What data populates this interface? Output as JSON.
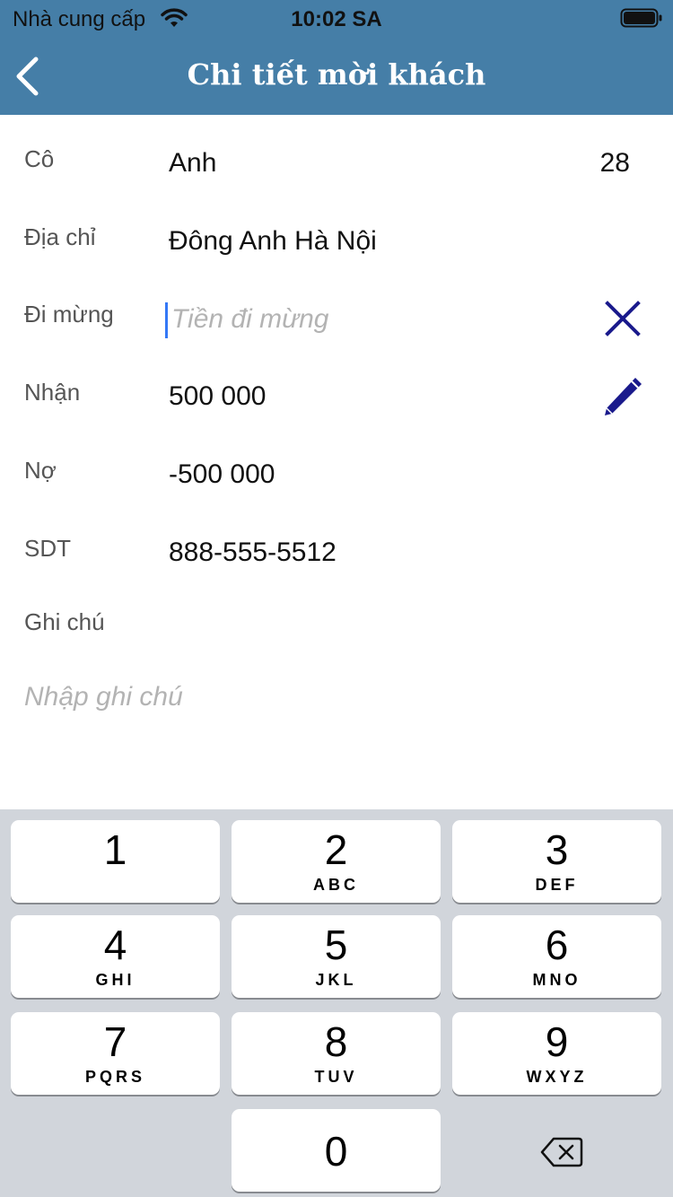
{
  "status_bar": {
    "carrier": "Nhà cung cấp",
    "time": "10:02 SA",
    "wifi_icon": "wifi-icon",
    "battery_icon": "battery-icon"
  },
  "header": {
    "title": "Chi tiết mời khách",
    "back_icon": "chevron-left-icon",
    "background_color": "#457ea7"
  },
  "form": {
    "guest": {
      "label": "Cô",
      "name": "Anh",
      "age": "28"
    },
    "address": {
      "label": "Địa chỉ",
      "value": "Đông Anh Hà Nội"
    },
    "gift": {
      "label": "Đi mừng",
      "value": "",
      "placeholder": "Tiền đi mừng",
      "clear_icon": "close-icon"
    },
    "received": {
      "label": "Nhận",
      "value": "500 000",
      "edit_icon": "pencil-icon"
    },
    "debt": {
      "label": "Nợ",
      "value": "-500 000"
    },
    "phone": {
      "label": "SDT",
      "value": "888-555-5512"
    },
    "note": {
      "label": "Ghi chú",
      "placeholder": "Nhập ghi chú"
    }
  },
  "keyboard": {
    "keys": [
      {
        "digit": "1",
        "letters": ""
      },
      {
        "digit": "2",
        "letters": "ABC"
      },
      {
        "digit": "3",
        "letters": "DEF"
      },
      {
        "digit": "4",
        "letters": "GHI"
      },
      {
        "digit": "5",
        "letters": "JKL"
      },
      {
        "digit": "6",
        "letters": "MNO"
      },
      {
        "digit": "7",
        "letters": "PQRS"
      },
      {
        "digit": "8",
        "letters": "TUV"
      },
      {
        "digit": "9",
        "letters": "WXYZ"
      },
      {
        "digit": "0",
        "letters": ""
      }
    ],
    "delete_icon": "backspace-icon"
  },
  "colors": {
    "accent": "#457ea7",
    "icon_navy": "#1a1a8c",
    "caret": "#3478f6",
    "keyboard_bg": "#d1d5db"
  }
}
